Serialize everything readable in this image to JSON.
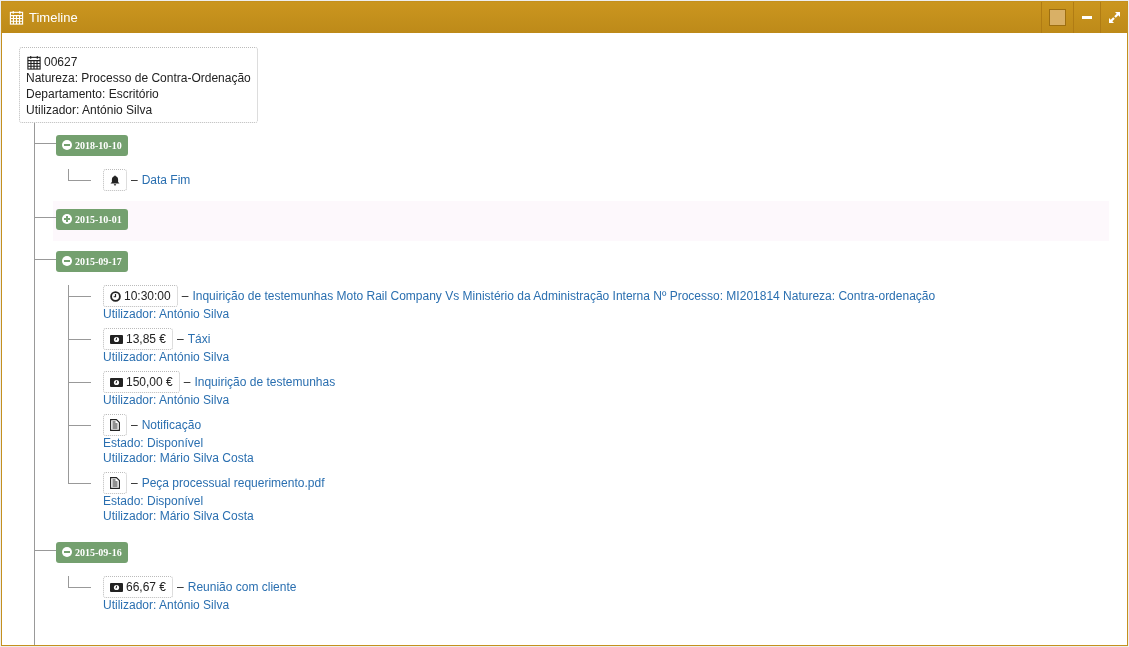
{
  "panel": {
    "title": "Timeline"
  },
  "record": {
    "number": "00627",
    "lines": [
      "Natureza: Processo de Contra-Ordenação",
      "Departamento: Escritório",
      "Utilizador: António Silva"
    ]
  },
  "groups": [
    {
      "date": "2018-10-10",
      "expanded": true,
      "highlighted": false,
      "items": [
        {
          "kind": "bell",
          "separator": "–",
          "title": "Data Fim"
        }
      ]
    },
    {
      "date": "2015-10-01",
      "expanded": false,
      "highlighted": true
    },
    {
      "date": "2015-09-17",
      "expanded": true,
      "highlighted": false,
      "items": [
        {
          "kind": "time",
          "badge": "10:30:00",
          "separator": "–",
          "title": "Inquirição de testemunhas Moto Rail Company Vs Ministério da Administração Interna Nº Processo: MI201814 Natureza: Contra-ordenação",
          "details": [
            "Utilizador: António Silva"
          ]
        },
        {
          "kind": "money",
          "badge": "13,85 €",
          "separator": "–",
          "title": "Táxi",
          "details": [
            "Utilizador: António Silva"
          ]
        },
        {
          "kind": "money",
          "badge": "150,00 €",
          "separator": "–",
          "title": "Inquirição de testemunhas",
          "details": [
            "Utilizador: António Silva"
          ]
        },
        {
          "kind": "doc",
          "separator": "–",
          "title": "Notificação",
          "details": [
            "Estado: Disponível",
            "Utilizador: Mário Silva Costa"
          ]
        },
        {
          "kind": "doc",
          "separator": "–",
          "title": "Peça processual requerimento.pdf",
          "details": [
            "Estado: Disponível",
            "Utilizador: Mário Silva Costa"
          ]
        }
      ]
    },
    {
      "date": "2015-09-16",
      "expanded": true,
      "highlighted": false,
      "items": [
        {
          "kind": "money",
          "badge": "66,67 €",
          "separator": "–",
          "title": "Reunião com cliente",
          "details": [
            "Utilizador: António Silva"
          ]
        }
      ]
    }
  ]
}
